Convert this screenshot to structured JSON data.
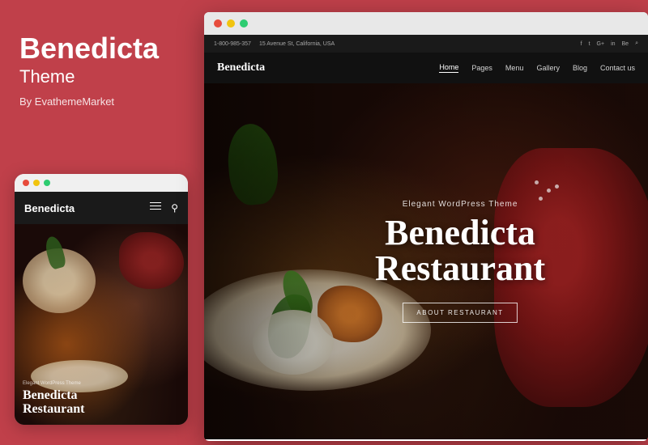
{
  "left": {
    "title": "Benedicta",
    "subtitle": "Theme",
    "author": "By EvathemeMarket",
    "background_color": "#c0404a"
  },
  "mobile_preview": {
    "dots": [
      "red",
      "yellow",
      "green"
    ],
    "nav": {
      "logo": "Benedicta"
    },
    "hero": {
      "small_text": "Elegant WordPress Theme",
      "title_line1": "Benedicta",
      "title_line2": "Restaurant"
    }
  },
  "desktop_preview": {
    "dots": [
      "red",
      "yellow",
      "green"
    ],
    "top_bar": {
      "phone": "1-800-985-357",
      "address": "15 Avenue St, California, USA",
      "socials": [
        "f",
        "tw",
        "G+",
        "in",
        "Be"
      ]
    },
    "nav": {
      "logo": "Benedicta",
      "menu_items": [
        "Home",
        "Pages",
        "Menu",
        "Gallery",
        "Blog",
        "Contact us"
      ],
      "active_item": "Home"
    },
    "hero": {
      "subtitle": "Elegant WordPress Theme",
      "title_line1": "Benedicta",
      "title_line2": "Restaurant",
      "cta_button": "ABOUT RESTAURANT"
    }
  }
}
